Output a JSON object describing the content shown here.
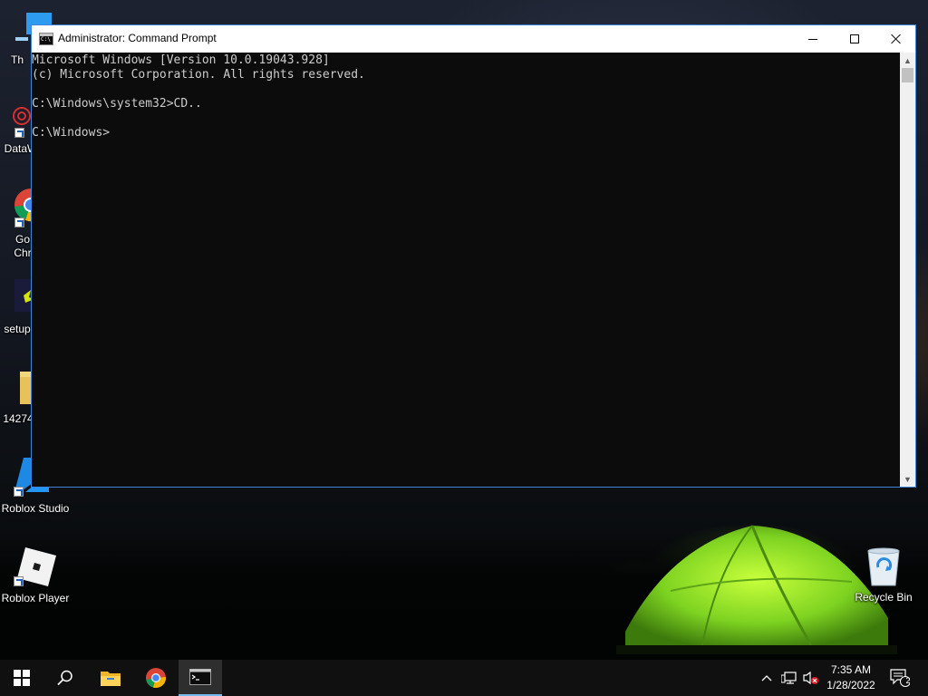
{
  "desktop": {
    "icons": [
      {
        "label": "Th",
        "icon": "this-pc-icon"
      },
      {
        "label": "DataW",
        "icon": "datawrangler-icon"
      },
      {
        "label_line1": "Go",
        "label_line2": "Chr",
        "icon": "google-chrome-icon"
      },
      {
        "label": "setup",
        "icon": "setup-icon"
      },
      {
        "label": "14274",
        "icon": "folder-icon"
      },
      {
        "label": "Roblox Studio",
        "icon": "roblox-studio-icon"
      },
      {
        "label": "Roblox Player",
        "icon": "roblox-player-icon"
      },
      {
        "label": "Recycle Bin",
        "icon": "recycle-bin-icon"
      }
    ]
  },
  "cmd_window": {
    "title": "Administrator: Command Prompt",
    "console_lines": [
      "Microsoft Windows [Version 10.0.19043.928]",
      "(c) Microsoft Corporation. All rights reserved.",
      "",
      "C:\\Windows\\system32>CD..",
      "",
      "C:\\Windows>"
    ],
    "colors": {
      "background": "#0c0c0c",
      "text": "#cccccc",
      "border": "#3f84d8"
    }
  },
  "taskbar": {
    "pinned": [
      "start-icon",
      "search-icon",
      "file-explorer-icon",
      "google-chrome-icon",
      "command-prompt-icon"
    ],
    "active": "command-prompt-icon",
    "tray_icons": [
      "show-hidden-icons-chevron",
      "network-icon",
      "volume-muted-icon"
    ],
    "clock": {
      "time": "7:35 AM",
      "date": "1/28/2022"
    },
    "notification_count": "2",
    "accent": "#76b9ed"
  }
}
